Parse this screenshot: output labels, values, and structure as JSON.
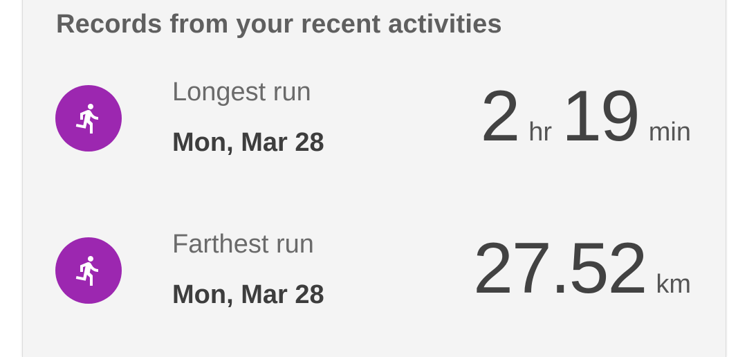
{
  "card": {
    "title": "Records from your recent activities"
  },
  "records": [
    {
      "name": "Longest run",
      "date": "Mon, Mar 28",
      "icon": "running-person-icon",
      "value_parts": [
        {
          "number": "2",
          "unit": "hr"
        },
        {
          "number": "19",
          "unit": "min"
        }
      ]
    },
    {
      "name": "Farthest run",
      "date": "Mon, Mar 28",
      "icon": "running-person-icon",
      "value_parts": [
        {
          "number": "27.52",
          "unit": "km"
        }
      ]
    }
  ],
  "colors": {
    "icon_background": "#9c27b0",
    "card_background": "#f4f4f4",
    "primary_text": "#424242",
    "secondary_text": "#6a6a6a"
  }
}
